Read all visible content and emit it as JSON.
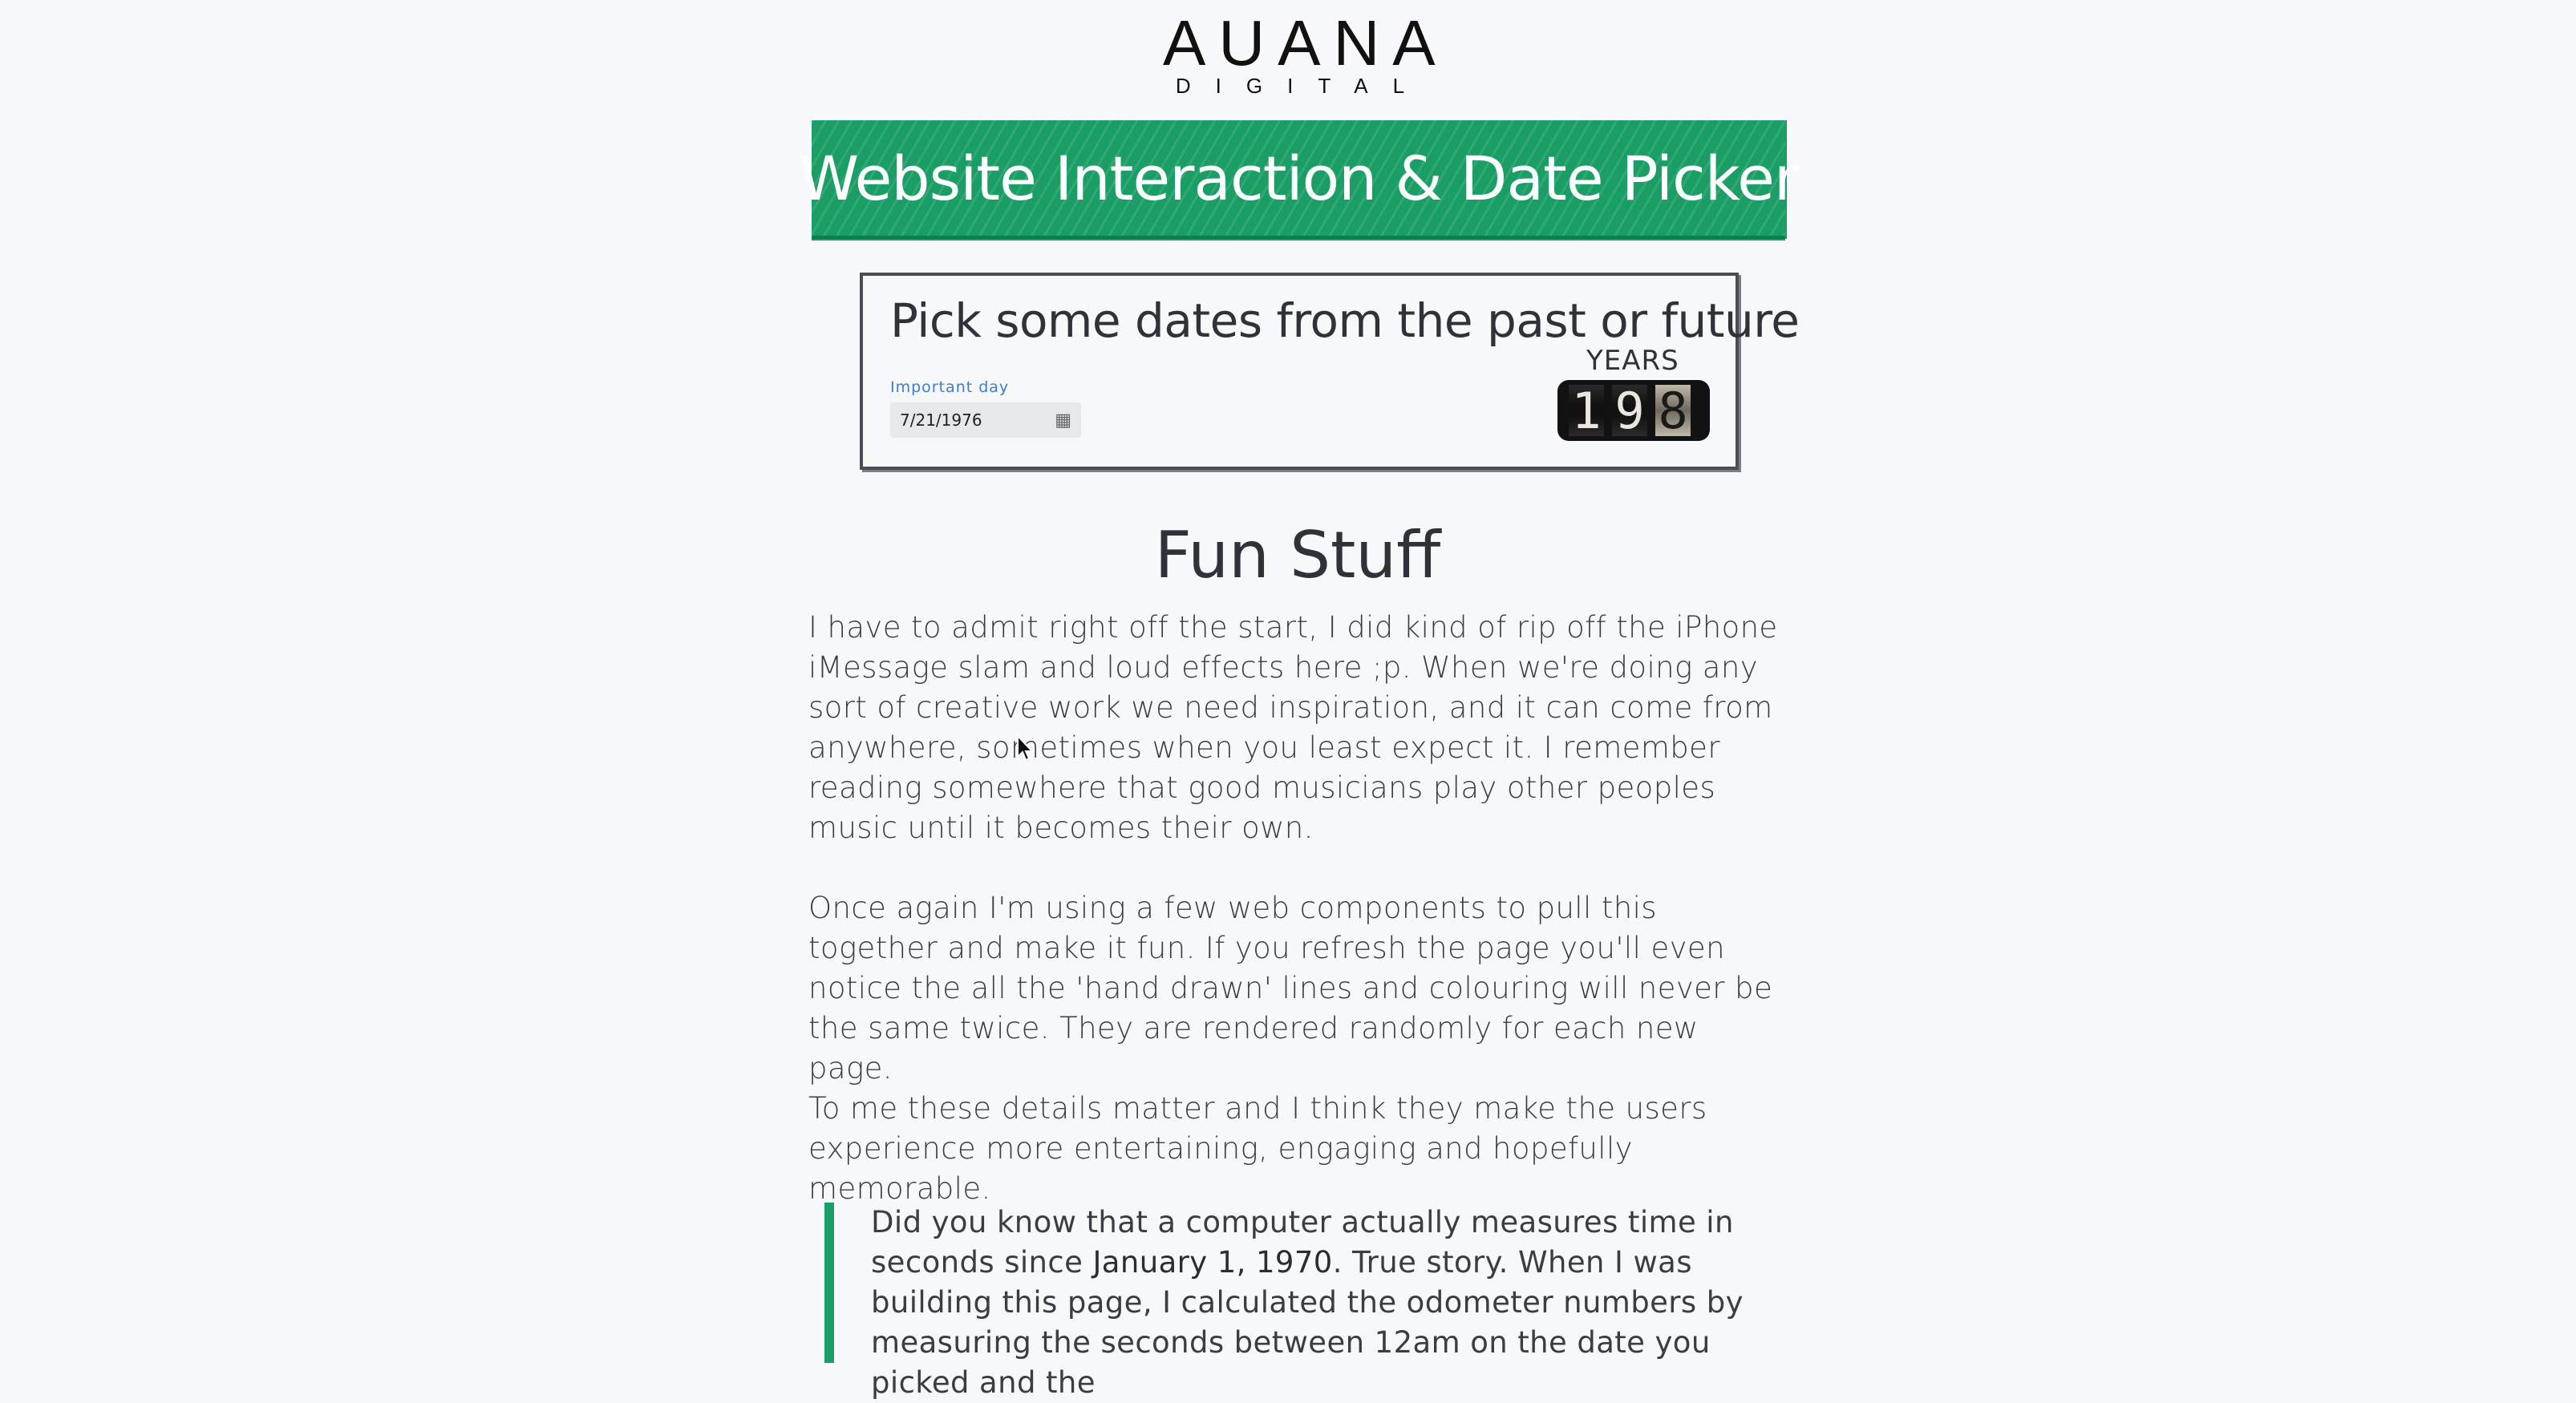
{
  "logo": {
    "main": "AUANA",
    "sub": "DIGITAL"
  },
  "banner": {
    "title": "Website Interaction & Date Picker"
  },
  "picker_card": {
    "title": "Pick some dates from the past or future",
    "field_label": "Important day",
    "date_value": "7/21/1976",
    "years_label": "YEARS",
    "odometer_digits": [
      "1",
      "9",
      "8"
    ]
  },
  "article": {
    "heading": "Fun Stuff",
    "paragraph_1": "I have to admit right off the start, I did kind of rip off the iPhone iMessage slam and loud effects here ;p. When we're doing any sort of creative work we need inspiration, and it can come from anywhere, sometimes when you least expect it. I remember reading somewhere that good musicians play other peoples music until it becomes their own.",
    "paragraph_2": "Once again I'm using a few web components to pull this together and make it fun. If you refresh the page you'll even notice the all the 'hand drawn' lines and colouring will never be the same twice. They are rendered randomly for each new page.",
    "paragraph_3": "To me these details matter and I think they make the users experience more entertaining, engaging and hopefully memorable.",
    "quote_before": "Did you know that a computer actually measures time in seconds since ",
    "quote_bold": "January 1, 1970",
    "quote_after": ". True story. When I was building this page, I calculated the odometer numbers by measuring the seconds between 12am on the date you picked and the"
  },
  "colors": {
    "accent": "#1a9e65",
    "label_blue": "#3a7bd5",
    "background": "#f7f8fa"
  },
  "icons": {
    "calendar": "calendar-icon",
    "cursor": "mouse-pointer-icon"
  }
}
